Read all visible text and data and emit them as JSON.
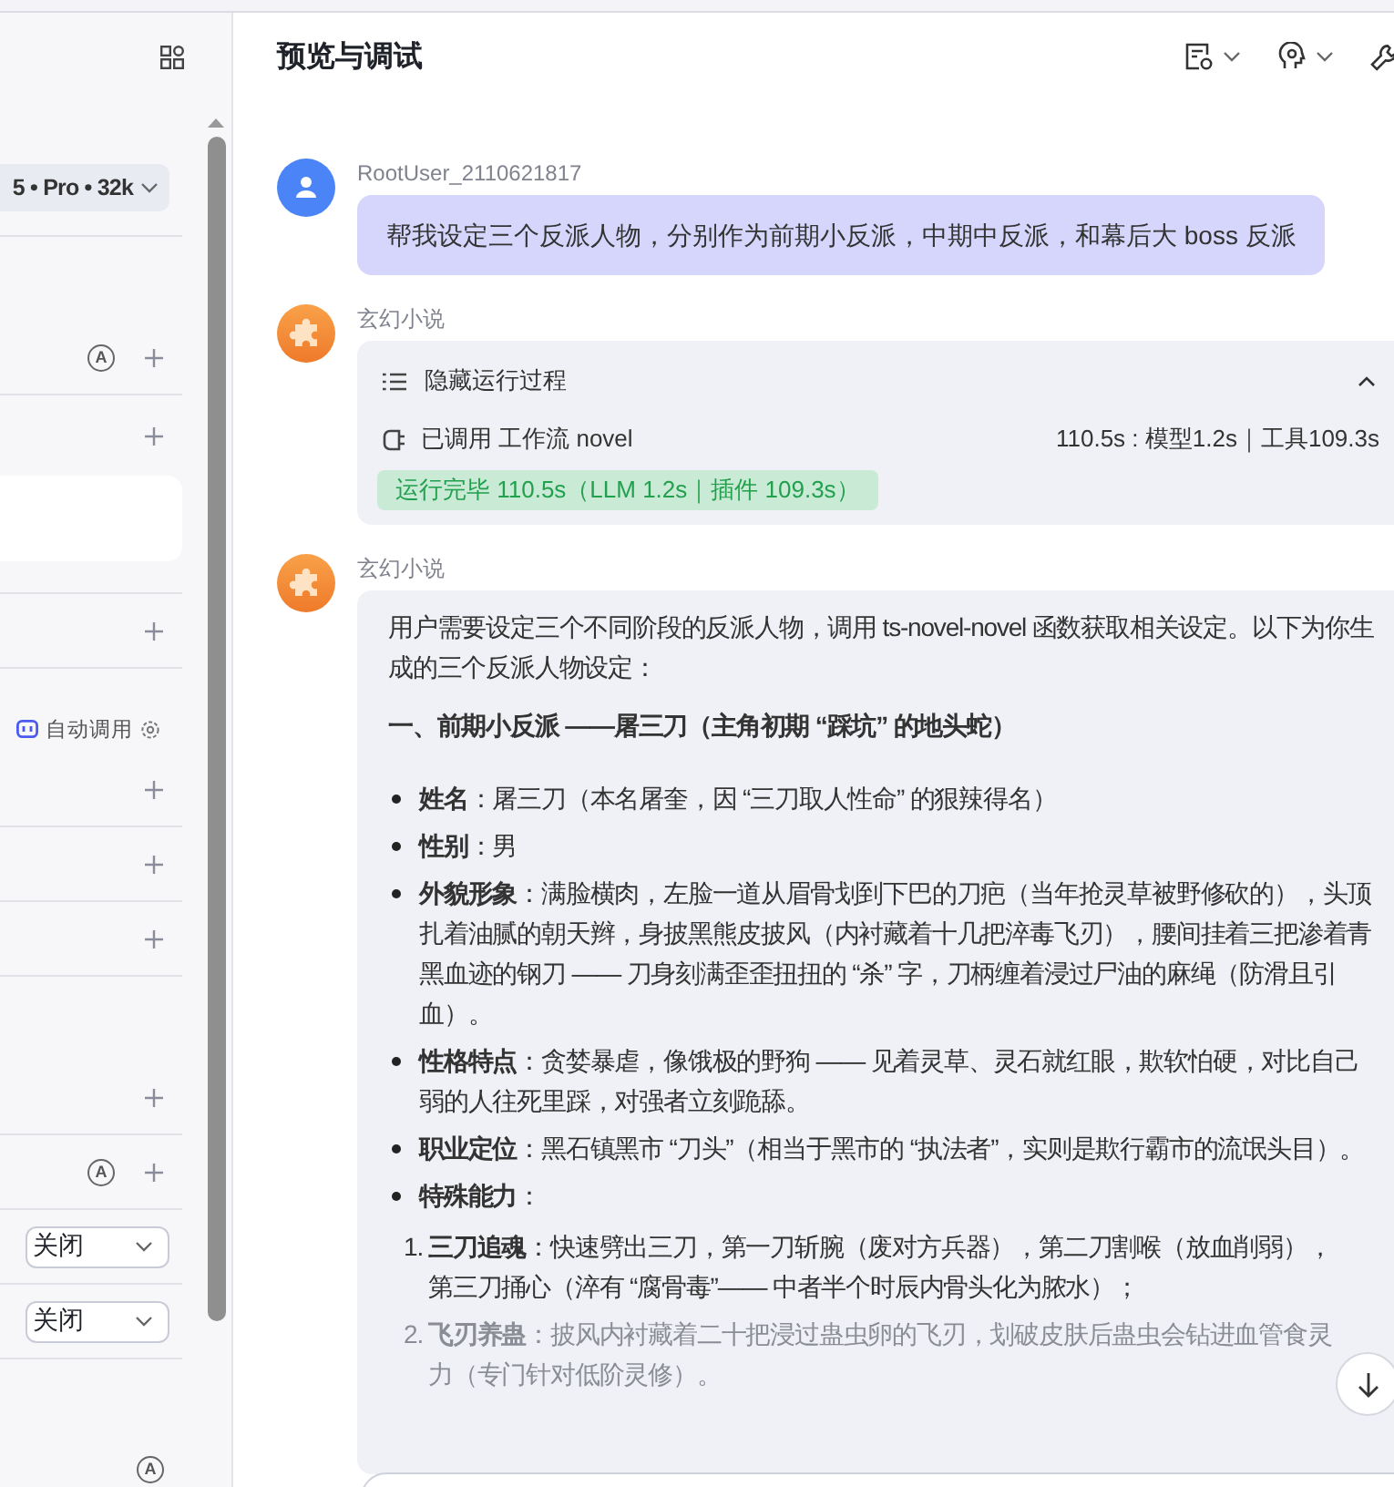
{
  "sidebar": {
    "sections": [
      {
        "kind": "model",
        "label": "5 • Pro • 32k"
      },
      {
        "kind": "add",
        "badge": "A"
      },
      {
        "kind": "card"
      },
      {
        "kind": "add"
      },
      {
        "kind": "auto",
        "label": "自动调用"
      },
      {
        "kind": "add"
      },
      {
        "kind": "add"
      },
      {
        "kind": "add"
      },
      {
        "kind": "add",
        "badge": "A"
      },
      {
        "kind": "select",
        "value": "关闭"
      },
      {
        "kind": "select",
        "value": "关闭"
      },
      {
        "kind": "footer",
        "badge": "A"
      }
    ]
  },
  "preview": {
    "title": "预览与调试",
    "messages": [
      {
        "kind": "user",
        "author": "RootUser_2110621817",
        "text": "帮我设定三个反派人物，分别作为前期小反派，中期中反派，和幕后大 boss 反派"
      },
      {
        "kind": "run",
        "author": "玄幻小说",
        "toggle": "隐藏运行过程",
        "expanded": true,
        "call": "已调用 工作流 novel",
        "timing": "110.5s : 模型1.2s｜工具109.3s",
        "status": "运行完毕 110.5s（LLM 1.2s｜插件 109.3s）"
      },
      {
        "kind": "answer",
        "author": "玄幻小说",
        "blocks": [
          {
            "kind": "p",
            "text": "用户需要设定三个不同阶段的反派人物，调用 ts-novel-novel 函数获取相关设定。以下为你生成的三个反派人物设定："
          },
          {
            "kind": "h",
            "text": "一、前期小反派 ——屠三刀（主角初期 “踩坑” 的地头蛇）"
          },
          {
            "kind": "ul",
            "items": [
              {
                "text": "**姓名**：屠三刀（本名屠奎，因 “三刀取人性命” 的狠辣得名）"
              },
              {
                "text": "**性别**：男"
              },
              {
                "text": "**外貌形象**：满脸横肉，左脸一道从眉骨划到下巴的刀疤（当年抢灵草被野修砍的），头顶扎着油腻的朝天辫，身披黑熊皮披风（内衬藏着十几把淬毒飞刃），腰间挂着三把渗着青黑血迹的钢刀 —— 刀身刻满歪歪扭扭的 “杀” 字，刀柄缠着浸过尸油的麻绳（防滑且引血）。"
              },
              {
                "text": "**性格特点**：贪婪暴虐，像饿极的野狗 —— 见着灵草、灵石就红眼，欺软怕硬，对比自己弱的人往死里踩，对强者立刻跪舔。"
              },
              {
                "text": "**职业定位**：黑石镇黑市 “刀头”（相当于黑市的 “执法者”，实则是欺行霸市的流氓头目）。"
              },
              {
                "text": "**特殊能力**：",
                "children": [
                  {
                    "number": "1.",
                    "text": "**三刀追魂**：快速劈出三刀，第一刀斩腕（废对方兵器），第二刀割喉（放血削弱），第三刀捅心（淬有 “腐骨毒”—— 中者半个时辰内骨头化为脓水）；"
                  },
                  {
                    "number": "2.",
                    "text": "**飞刃养蛊**：披风内衬藏着二十把浸过蛊虫卵的飞刃，划破皮肤后蛊虫会钻进血管食灵力（专门针对低阶灵修）。"
                  }
                ]
              }
            ]
          }
        ]
      }
    ]
  }
}
